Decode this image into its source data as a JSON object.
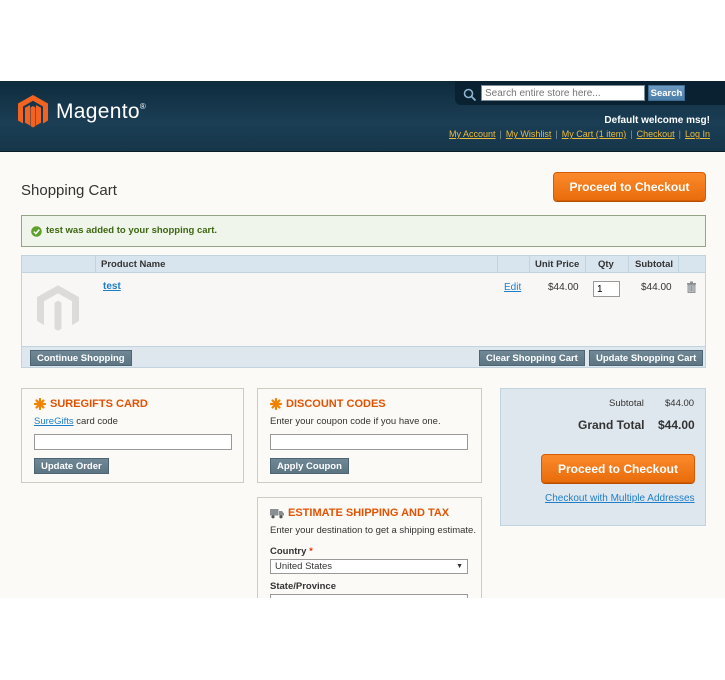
{
  "header": {
    "logo_text": "Magento",
    "logo_mark": "®",
    "search_placeholder": "Search entire store here...",
    "search_button": "Search",
    "welcome": "Default welcome msg!",
    "links": [
      "My Account",
      "My Wishlist",
      "My Cart (1 item)",
      "Checkout",
      "Log In"
    ],
    "separator": "|"
  },
  "page": {
    "title": "Shopping Cart",
    "checkout_button": "Proceed to Checkout",
    "success_message": "test was added to your shopping cart."
  },
  "cart": {
    "columns": {
      "product": "Product Name",
      "unit_price": "Unit Price",
      "qty": "Qty",
      "subtotal": "Subtotal"
    },
    "items": [
      {
        "name": "test",
        "edit": "Edit",
        "unit_price": "$44.00",
        "qty": "1",
        "subtotal": "$44.00"
      }
    ],
    "continue_button": "Continue Shopping",
    "clear_button": "Clear Shopping Cart",
    "update_button": "Update Shopping Cart"
  },
  "giftcard": {
    "title": "SUREGIFTS CARD",
    "link": "SureGifts",
    "label_rest": " card code",
    "button": "Update Order"
  },
  "discount": {
    "title": "DISCOUNT CODES",
    "label": "Enter your coupon code if you have one.",
    "button": "Apply Coupon"
  },
  "shipping": {
    "title": "ESTIMATE SHIPPING AND TAX",
    "label": "Enter your destination to get a shipping estimate.",
    "country_label": "Country",
    "required_mark": "*",
    "country_value": "United States",
    "state_label": "State/Province"
  },
  "totals": {
    "subtotal_label": "Subtotal",
    "subtotal_value": "$44.00",
    "grand_label": "Grand Total",
    "grand_value": "$44.00",
    "checkout_button": "Proceed to Checkout",
    "multi_address": "Checkout with Multiple Addresses"
  },
  "colors": {
    "accent": "#e96c0b",
    "header_bg": "#163649",
    "link": "#1e7ec8",
    "success": "#3d6611"
  }
}
